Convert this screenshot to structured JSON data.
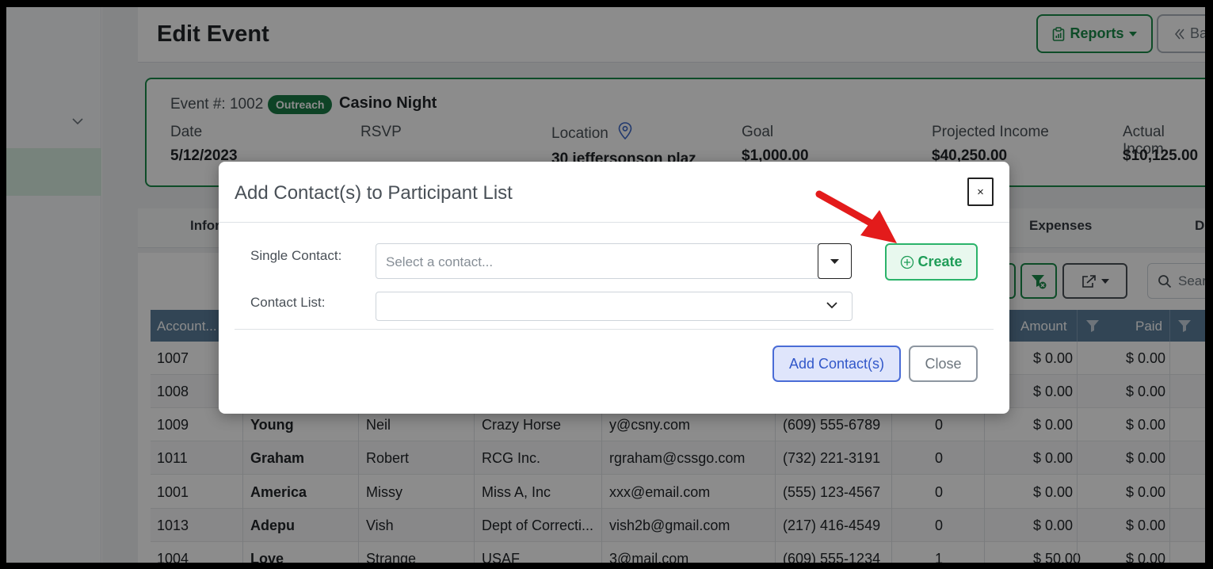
{
  "page": {
    "title": "Edit Event",
    "reports_label": "Reports",
    "back_label": "Ba"
  },
  "event": {
    "number_label": "Event #: 1002",
    "badge": "Outreach",
    "name": "Casino Night",
    "fields": [
      {
        "label": "Date",
        "value": "5/12/2023"
      },
      {
        "label": "RSVP",
        "value": ""
      },
      {
        "label": "Location",
        "value": "30 jeffersonson plaz"
      },
      {
        "label": "Goal",
        "value": "$1,000.00"
      },
      {
        "label": "Projected Income",
        "value": "$40,250.00"
      },
      {
        "label": "Actual Incom",
        "value": "$10,125.00"
      }
    ]
  },
  "tabs": [
    "Infor",
    "Expenses",
    "De"
  ],
  "toolbar": {
    "search_placeholder": "Sear"
  },
  "table": {
    "headers": [
      "Account...",
      "Amount",
      "Paid"
    ],
    "rows": [
      [
        "1007",
        "",
        "",
        "",
        "",
        "",
        "",
        "$ 0.00",
        "$ 0.00"
      ],
      [
        "1008",
        "",
        "",
        "",
        "",
        "",
        "",
        "$ 0.00",
        "$ 0.00"
      ],
      [
        "1009",
        "Young",
        "Neil",
        "Crazy Horse",
        "y@csny.com",
        "(609) 555-6789",
        "0",
        "$ 0.00",
        "$ 0.00"
      ],
      [
        "1011",
        "Graham",
        "Robert",
        "RCG Inc.",
        "rgraham@cssgo.com",
        "(732) 221-3191",
        "0",
        "$ 0.00",
        "$ 0.00"
      ],
      [
        "1001",
        "America",
        "Missy",
        "Miss A, Inc",
        "xxx@email.com",
        "(555) 123-4567",
        "0",
        "$ 0.00",
        "$ 0.00"
      ],
      [
        "1013",
        "Adepu",
        "Vish",
        "Dept of Correcti...",
        "vish2b@gmail.com",
        "(217) 416-4549",
        "0",
        "$ 0.00",
        "$ 0.00"
      ],
      [
        "1004",
        "Love",
        "Strange",
        "USAF",
        "3@mail.com",
        "(609) 555-1234",
        "1",
        "$ 50.00",
        "$ 0.00"
      ]
    ]
  },
  "modal": {
    "title": "Add Contact(s) to Participant List",
    "close_symbol": "×",
    "single_label": "Single Contact:",
    "single_placeholder": "Select a contact...",
    "list_label": "Contact List:",
    "create_label": "Create",
    "add_label": "Add Contact(s)",
    "close_label": "Close"
  },
  "colors": {
    "brand_green": "#1b8a4a",
    "primary_blue": "#4a6cd6",
    "annotation_red": "#e31b1b",
    "table_header": "#5b7e9c"
  }
}
